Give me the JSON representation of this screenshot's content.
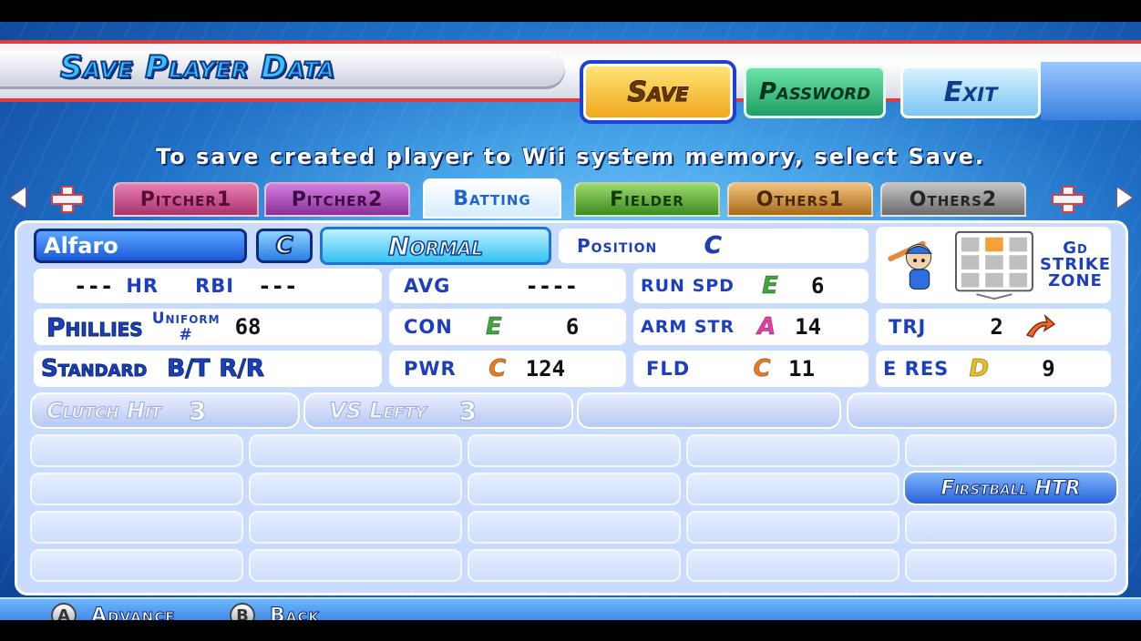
{
  "header": {
    "title": "Save Player Data",
    "save_label": "Save",
    "password_label": "Password",
    "exit_label": "Exit"
  },
  "instruction": "To save created player to Wii system memory, select Save.",
  "tabs": [
    {
      "label": "Pitcher1",
      "color": "#d64b8e"
    },
    {
      "label": "Pitcher2",
      "color": "#b53ab8"
    },
    {
      "label": "Batting",
      "color": "#ffffff"
    },
    {
      "label": "Fielder",
      "color": "#6fbd3d"
    },
    {
      "label": "Others1",
      "color": "#d99a3a"
    },
    {
      "label": "Others2",
      "color": "#8c8c8c"
    }
  ],
  "player": {
    "name": "Alfaro",
    "position_badge": "C",
    "type": "Normal",
    "position_label": "Position",
    "position_value": "C",
    "hr_dashes": "---",
    "hr_label": "HR",
    "rbi_label": "RBI",
    "rbi_dashes": "---",
    "avg_label": "AVG",
    "avg_dashes": "----",
    "run_spd_label": "RUN SPD",
    "run_spd_grade": "E",
    "run_spd_value": "6",
    "team": "Phillies",
    "uniform_label_line1": "Uniform",
    "uniform_label_line2": "#",
    "uniform_number": "68",
    "con_label": "CON",
    "con_grade": "E",
    "con_value": "6",
    "arm_str_label": "ARM STR",
    "arm_str_grade": "A",
    "arm_str_value": "14",
    "trj_label": "TRJ",
    "trj_value": "2",
    "form": "Standard",
    "bt_label": "B/T",
    "bt_value": "R/R",
    "pwr_label": "PWR",
    "pwr_grade": "C",
    "pwr_value": "124",
    "fld_label": "FLD",
    "fld_grade": "C",
    "fld_value": "11",
    "eres_label": "E RES",
    "eres_grade": "D",
    "eres_value": "9",
    "strike_zone_line1": "Gd",
    "strike_zone_line2": "STRIKE",
    "strike_zone_line3": "ZONE"
  },
  "abilities": [
    {
      "name": "Clutch Hit",
      "value": "3"
    },
    {
      "name": "VS Lefty",
      "value": "3"
    }
  ],
  "special_ability": "Firstball HTR",
  "footer": {
    "a_key": "A",
    "advance_label": "Advance",
    "b_key": "B",
    "back_label": "Back"
  },
  "colors": {
    "grade_A": "#e83aa8",
    "grade_C": "#f07a1a",
    "grade_D": "#e8c21a",
    "grade_E": "#3ea83a"
  }
}
